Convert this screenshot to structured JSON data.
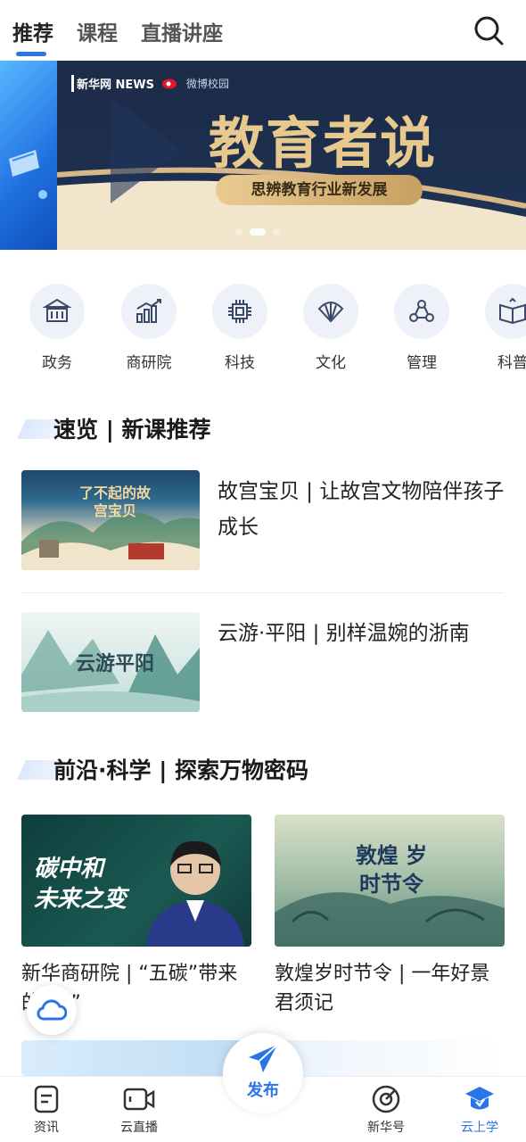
{
  "tabs": [
    {
      "label": "推荐",
      "active": true
    },
    {
      "label": "课程",
      "active": false
    },
    {
      "label": "直播讲座",
      "active": false
    }
  ],
  "search_icon": "search-icon",
  "banner": {
    "logo_xinhua": "新华网 NEWS",
    "logo_weibo": "微博校园",
    "title": "教育者说",
    "subtitle": "思辨教育行业新发展",
    "slide_count": 3,
    "active_slide": 2
  },
  "categories": [
    {
      "label": "政务",
      "icon": "government-building-icon"
    },
    {
      "label": "商研院",
      "icon": "bar-chart-icon"
    },
    {
      "label": "科技",
      "icon": "chip-icon"
    },
    {
      "label": "文化",
      "icon": "fan-icon"
    },
    {
      "label": "管理",
      "icon": "people-network-icon"
    },
    {
      "label": "科普",
      "icon": "open-book-icon"
    }
  ],
  "section1": {
    "title": "速览 | 新课推荐",
    "courses": [
      {
        "title": "故宫宝贝 | 让故宫文物陪伴孩子成长",
        "thumb_text": "了不起的故宫宝贝"
      },
      {
        "title": "云游·平阳 | 别样温婉的浙南",
        "thumb_text": "云游平阳"
      }
    ]
  },
  "section2": {
    "title": "前沿·科学 | 探索万物密码",
    "cards": [
      {
        "title": "新华商研院 | “五碳”带来的“变”",
        "thumb_text": "碳中和 未来之变"
      },
      {
        "title": "敦煌岁时节令 | 一年好景君须记",
        "thumb_text": "敦煌 岁时节令"
      }
    ]
  },
  "floating_button_icon": "cloud-icon",
  "bottom_nav": [
    {
      "label": "资讯",
      "icon": "document-icon",
      "active": false
    },
    {
      "label": "云直播",
      "icon": "video-icon",
      "active": false
    },
    {
      "label": "发布",
      "icon": "send-icon",
      "active": false
    },
    {
      "label": "新华号",
      "icon": "target-icon",
      "active": false
    },
    {
      "label": "云上学",
      "icon": "graduation-cap-icon",
      "active": true
    }
  ],
  "colors": {
    "accent": "#2a73e8",
    "banner_bg": "#1c2a45",
    "gold": "#e8c98d"
  }
}
